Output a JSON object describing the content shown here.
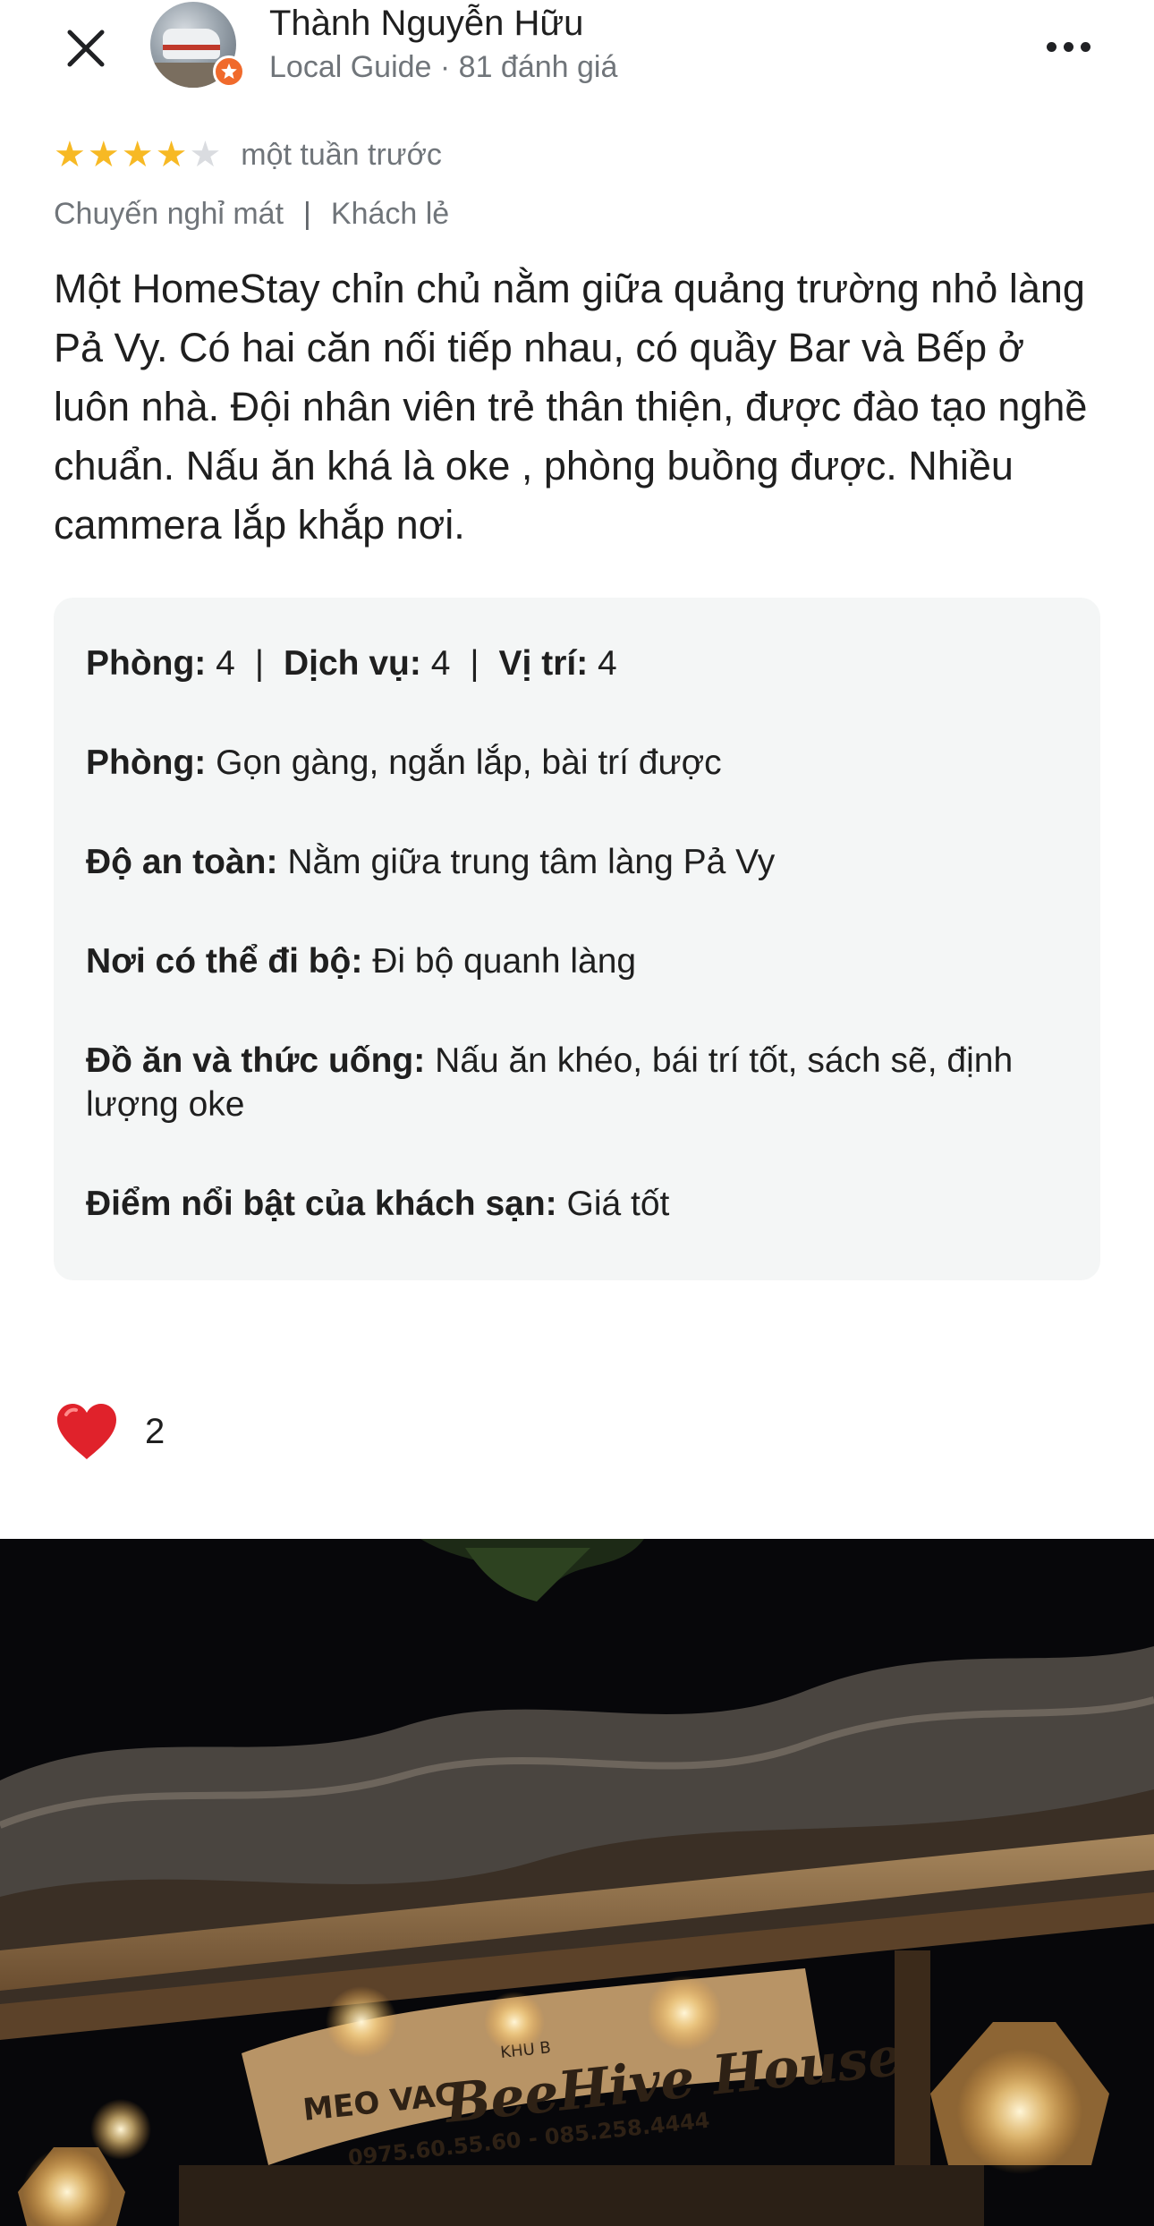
{
  "header": {
    "user_name": "Thành Nguyễn Hữu",
    "user_meta": "Local Guide · 81 đánh giá"
  },
  "review": {
    "rating": 4,
    "rating_max": 5,
    "time": "một tuần trước",
    "tags": [
      "Chuyến nghỉ mát",
      "Khách lẻ"
    ],
    "text": "Một HomeStay chỉn chủ nằm giữa quảng trường nhỏ làng Pả Vy. Có hai căn nối tiếp nhau, có quầy Bar và Bếp ở luôn nhà. Đội nhân viên trẻ thân thiện, được đào tạo nghề chuẩn. Nấu ăn khá là oke , phòng buồng được. Nhiều cammera lắp khắp nơi."
  },
  "scores": {
    "room_label": "Phòng:",
    "room_value": "4",
    "service_label": "Dịch vụ:",
    "service_value": "4",
    "location_label": "Vị trí:",
    "location_value": "4"
  },
  "attributes": [
    {
      "label": "Phòng:",
      "value": "Gọn gàng, ngắn lắp, bài trí được"
    },
    {
      "label": "Độ an toàn:",
      "value": "Nằm giữa trung tâm làng Pả Vy"
    },
    {
      "label": "Nơi có thể đi bộ:",
      "value": "Đi bộ quanh làng"
    },
    {
      "label": "Đồ ăn và thức uống:",
      "value": "Nấu ăn khéo, bái trí tốt, sách sẽ, định lượng oke"
    },
    {
      "label": "Điểm nổi bật của khách sạn:",
      "value": "Giá tốt"
    }
  ],
  "likes": {
    "count": "2"
  },
  "photo": {
    "sign_small_top": "KHU B",
    "sign_left": "MEO VAC",
    "sign_title": "BeeHive House",
    "sign_phones": "0975.60.55.60 - 085.258.4444"
  },
  "colors": {
    "star_on": "#f7b924",
    "star_off": "#dadce0",
    "badge": "#f06a2c",
    "heart": "#e0222b",
    "box_bg": "#f4f6f6"
  },
  "icons": {
    "close": "close-icon",
    "more": "more-horiz-icon",
    "badge": "local-guide-star-icon",
    "like": "heart-icon"
  }
}
